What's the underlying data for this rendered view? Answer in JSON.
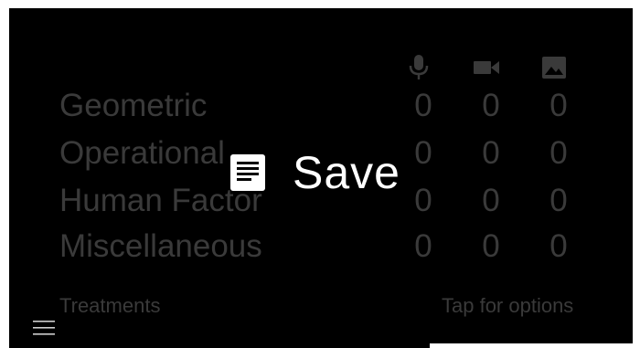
{
  "columns": [
    {
      "icon": "microphone-icon"
    },
    {
      "icon": "video-camera-icon"
    },
    {
      "icon": "image-icon"
    }
  ],
  "rows": [
    {
      "label": "Geometric",
      "counts": [
        "0",
        "0",
        "0"
      ]
    },
    {
      "label": "Operational",
      "counts": [
        "0",
        "0",
        "0"
      ]
    },
    {
      "label": "Human Factor",
      "counts": [
        "0",
        "0",
        "0"
      ]
    },
    {
      "label": "Miscellaneous",
      "counts": [
        "0",
        "0",
        "0"
      ]
    }
  ],
  "footer": {
    "left": "Treatments",
    "right": "Tap for options"
  },
  "overlay": {
    "icon": "note-icon",
    "label": "Save"
  },
  "colors": {
    "background": "#000000",
    "dim_text": "#3a3a3a",
    "overlay_text": "#ffffff"
  }
}
